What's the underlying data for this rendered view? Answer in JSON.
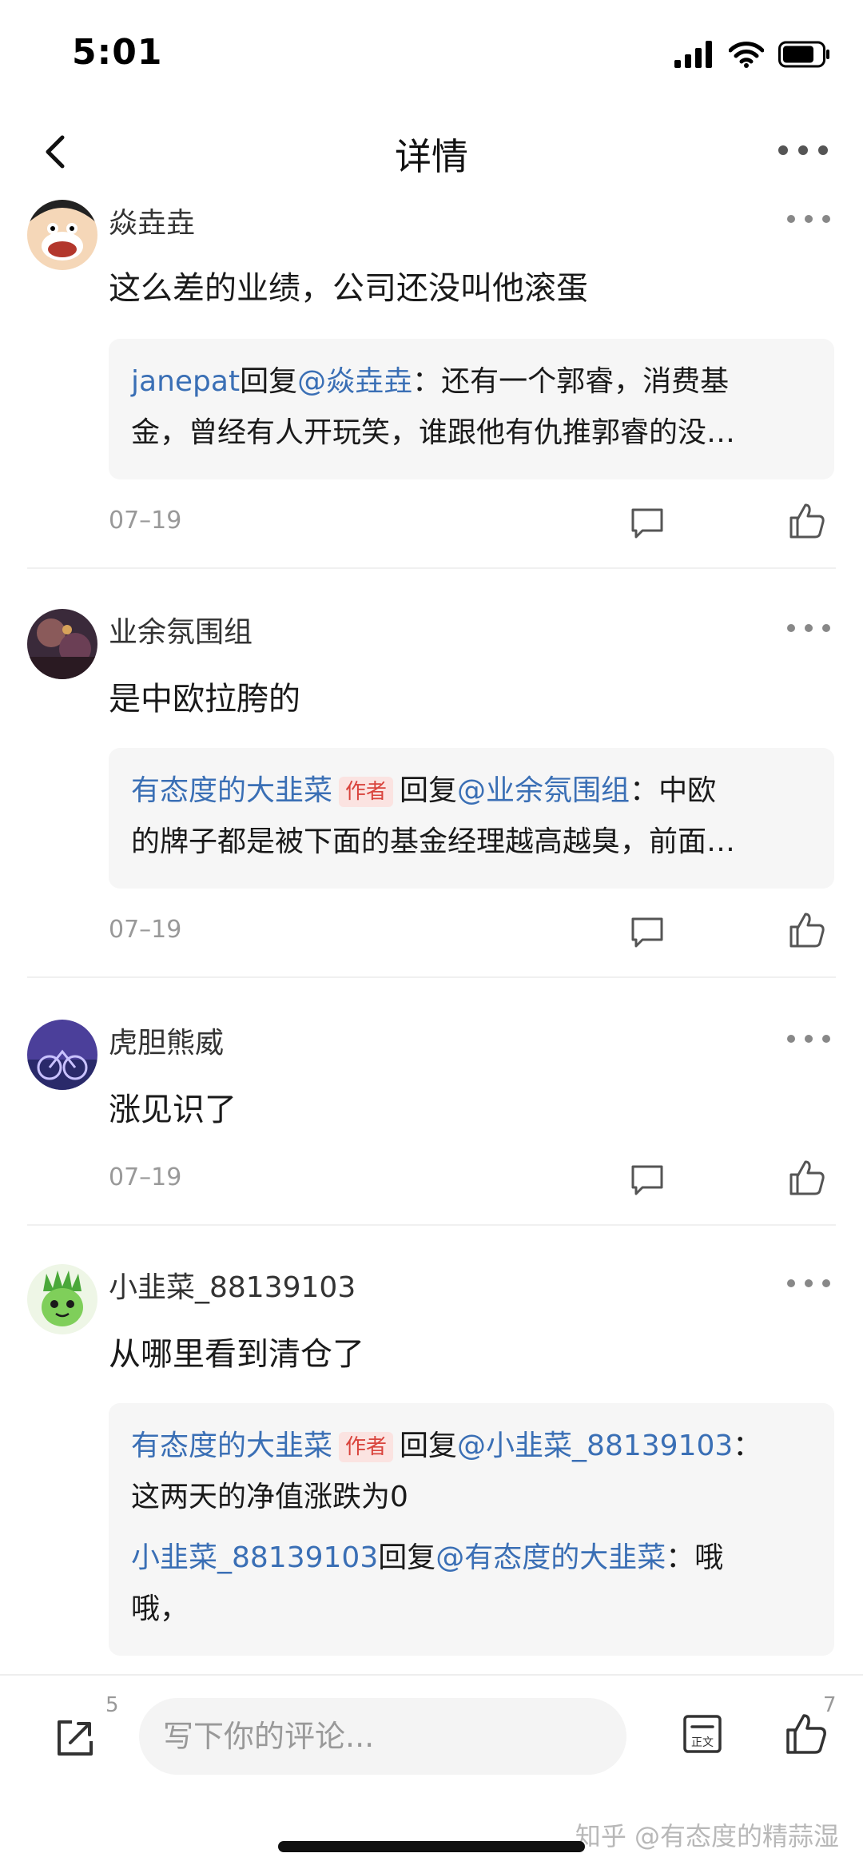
{
  "status_bar": {
    "time": "5:01"
  },
  "nav": {
    "title": "详情"
  },
  "comments": [
    {
      "username": "焱垚垚",
      "text": "这么差的业绩，公司还没叫他滚蛋",
      "date": "07–19",
      "replies": [
        {
          "author": "janepat",
          "is_author_tag": false,
          "reply_word": "回复",
          "target": "@焱垚垚",
          "line1": "：还有一个郭睿，消费基",
          "line2": "金，曾经有人开玩笑，谁跟他有仇推郭睿的没…"
        }
      ]
    },
    {
      "username": "业余氛围组",
      "text": "是中欧拉胯的",
      "date": "07–19",
      "replies": [
        {
          "author": "有态度的大韭菜",
          "tag": "作者",
          "reply_word": "回复",
          "target": "@业余氛围组",
          "line1": "：中欧",
          "line2": "的牌子都是被下面的基金经理越高越臭，前面…"
        }
      ]
    },
    {
      "username": "虎胆熊威",
      "text": "涨见识了",
      "date": "07–19"
    },
    {
      "username": "小韭菜_88139103",
      "text": "从哪里看到清仓了",
      "replies": [
        {
          "author": "有态度的大韭菜",
          "tag": "作者",
          "reply_word": "回复",
          "target": "@小韭菜_88139103",
          "line1": "：",
          "line2": "这两天的净值涨跌为0"
        },
        {
          "author": "小韭菜_88139103",
          "reply_word": "回复",
          "target": "@有态度的大韭菜",
          "line1": "：哦",
          "line2": "哦，"
        }
      ]
    }
  ],
  "bottom_bar": {
    "share_count": "5",
    "input_placeholder": "写下你的评论...",
    "like_count": "7",
    "watermark": "知乎 @有态度的精蒜湿"
  },
  "colors": {
    "link_blue": "#3a6fb5",
    "author_tag": "#d9433c"
  }
}
